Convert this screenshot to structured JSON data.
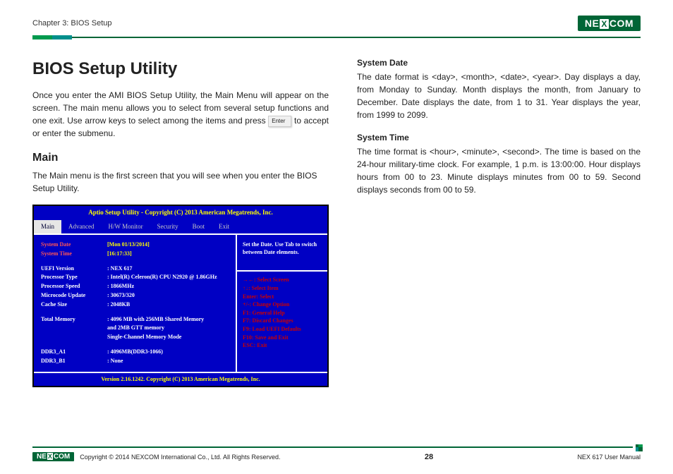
{
  "header": {
    "chapter": "Chapter 3: BIOS Setup",
    "logo": "NEXCOM"
  },
  "left": {
    "h1": "BIOS Setup Utility",
    "intro_a": "Once you enter the AMI BIOS Setup Utility, the Main Menu will appear on the screen. The main menu allows you to select from several setup functions and one exit. Use arrow keys to select among the items and press ",
    "enter": "Enter",
    "intro_b": " to accept or enter the submenu.",
    "h2": "Main",
    "main_desc": "The Main menu is the first screen that you will see when you enter the BIOS Setup Utility."
  },
  "right": {
    "sd_h": "System Date",
    "sd_p": "The date format is <day>, <month>, <date>, <year>. Day displays a day, from Monday to Sunday. Month displays the month, from January to December. Date displays the date, from 1 to 31. Year displays the year, from 1999 to 2099.",
    "st_h": "System Time",
    "st_p": "The time format is <hour>, <minute>, <second>. The time is based on the 24-hour military-time clock. For example, 1 p.m. is 13:00:00. Hour displays hours from 00 to 23. Minute displays minutes from 00 to 59. Second displays seconds from 00 to 59."
  },
  "bios": {
    "title": "Aptio Setup Utility - Copyright (C) 2013 American Megatrends, Inc.",
    "tabs": [
      "Main",
      "Advanced",
      "H/W Monitor",
      "Security",
      "Boot",
      "Exit"
    ],
    "rows": {
      "sysdate_l": "System Date",
      "sysdate_v": "[Mon 01/13/2014]",
      "systime_l": "System Time",
      "systime_v": "[16:17:33]",
      "uefi_l": "UEFI Version",
      "uefi_v": ": NEX 617",
      "ptype_l": "Processor Type",
      "ptype_v": ": Intel(R) Celeron(R) CPU N2920 @ 1.86GHz",
      "pspeed_l": "Processor Speed",
      "pspeed_v": ": 1866MHz",
      "mcode_l": "Microcode Update",
      "mcode_v": ": 30673/320",
      "cache_l": "Cache Size",
      "cache_v": ": 2048KB",
      "tmem_l": "Total Memory",
      "tmem_v": ": 4096 MB with 256MB Shared Memory",
      "tmem_v2": "  and 2MB GTT memory",
      "tmem_v3": "  Single-Channel Memory Mode",
      "ddra_l": "DDR3_A1",
      "ddra_v": ": 4096MB(DDR3-1066)",
      "ddrb_l": "DDR3_B1",
      "ddrb_v": ": None"
    },
    "help1": "Set the Date. Use Tab to switch between Date elements.",
    "keys": [
      "→←: Select Screen",
      "↑↓: Select Item",
      "Enter: Select",
      "+/-: Change Option",
      "F1: General Help",
      "F7: Discard Changes",
      "F9: Load UEFI Defaults",
      "F10: Save and Exit",
      "ESC: Exit"
    ],
    "footer": "Version 2.16.1242. Copyright (C) 2013 American Megatrends, Inc."
  },
  "footer": {
    "copy": "Copyright © 2014 NEXCOM International Co., Ltd. All Rights Reserved.",
    "page": "28",
    "manual": "NEX 617 User Manual"
  }
}
